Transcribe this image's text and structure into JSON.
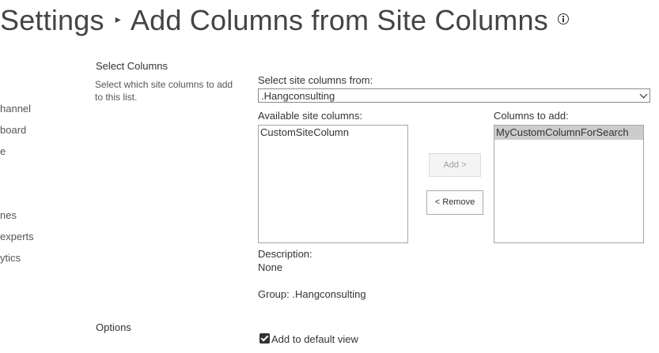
{
  "page": {
    "title_part1": "Settings",
    "title_part2": "Add Columns from Site Columns",
    "separator_glyph": "▸"
  },
  "left_nav": {
    "items": [
      "hannel",
      "board",
      "e",
      "nes",
      "experts",
      "ytics"
    ]
  },
  "select_columns": {
    "heading": "Select Columns",
    "description": "Select which site columns to add to this list.",
    "source_label": "Select site columns from:",
    "source_value": ".Hangconsulting",
    "available_label": "Available site columns:",
    "available_items": [
      "CustomSiteColumn"
    ],
    "toadd_label": "Columns to add:",
    "toadd_items": [
      "MyCustomColumnForSearch"
    ],
    "add_button": "Add >",
    "remove_button": "< Remove",
    "description_label": "Description:",
    "description_value": "None",
    "group_text": "Group: .Hangconsulting"
  },
  "options": {
    "heading": "Options",
    "add_default_view_label": "Add to default view",
    "add_default_view_checked": true
  },
  "colors": {
    "text": "#333333",
    "selected_bg": "#cccccc"
  }
}
